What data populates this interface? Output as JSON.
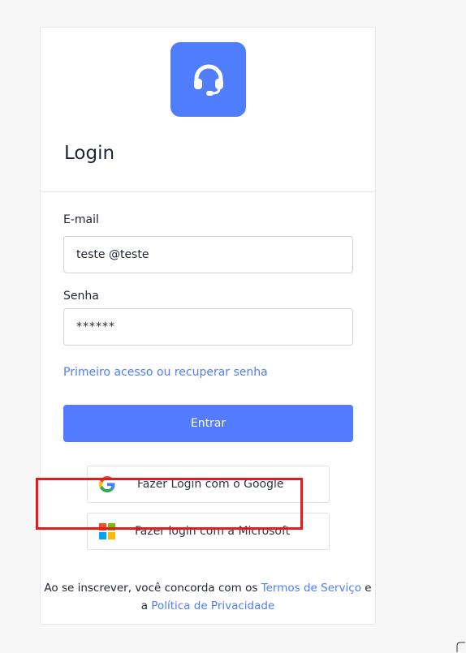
{
  "header": {
    "logo_icon": "headset-icon",
    "title": "Login"
  },
  "form": {
    "email_label": "E-mail",
    "email_value": "teste @teste",
    "password_label": "Senha",
    "password_value": "******",
    "recover_link": "Primeiro acesso ou recuperar senha",
    "submit_label": "Entrar"
  },
  "social": {
    "google_label": "Fazer Login com o Google",
    "microsoft_label": "Fazer login com a Microsoft"
  },
  "footer": {
    "text_before": "Ao se inscrever, você concorda com os ",
    "terms_link": "Termos de Serviço",
    "text_middle": " e a ",
    "privacy_link": "Política de Privacidade"
  },
  "colors": {
    "accent": "#537bff",
    "highlight_border": "#e31b1b",
    "link": "#4f7dfb"
  }
}
